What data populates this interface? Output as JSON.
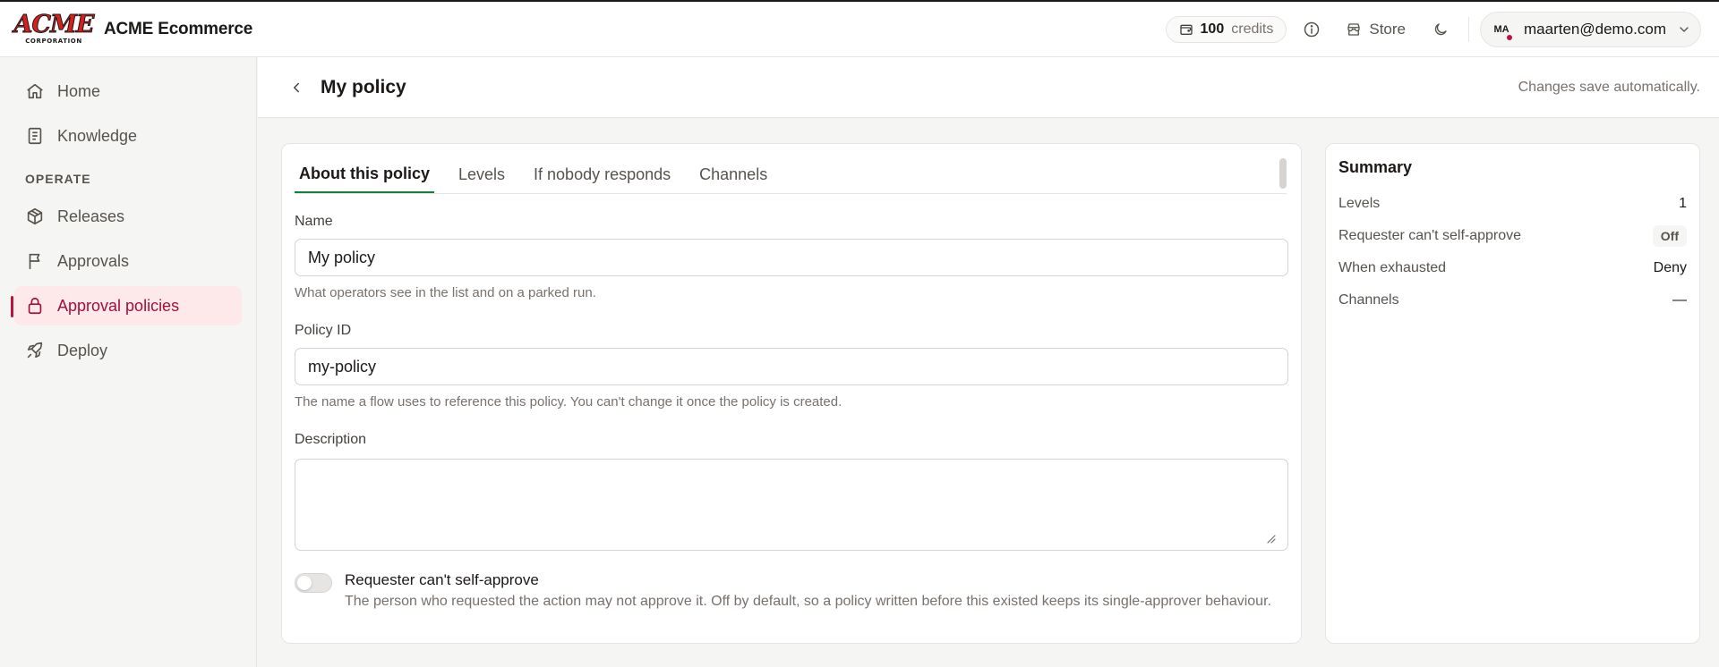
{
  "brand": {
    "logo_text": "ACME",
    "logo_subtext": "CORPORATION",
    "app_title": "ACME Ecommerce"
  },
  "topbar": {
    "credits_count": "100",
    "credits_label": "credits",
    "info_icon": "info-icon",
    "store_label": "Store",
    "theme_icon": "moon-icon",
    "user_initials": "MA",
    "user_email": "maarten@demo.com"
  },
  "sidebar": {
    "items": [
      {
        "label": "Home",
        "icon": "home-icon"
      },
      {
        "label": "Knowledge",
        "icon": "book-icon"
      }
    ],
    "section_label": "OPERATE",
    "operate_items": [
      {
        "label": "Releases",
        "icon": "package-icon"
      },
      {
        "label": "Approvals",
        "icon": "flag-icon"
      },
      {
        "label": "Approval policies",
        "icon": "lock-icon",
        "active": true
      },
      {
        "label": "Deploy",
        "icon": "rocket-icon"
      }
    ]
  },
  "header": {
    "title": "My policy",
    "autosave_note": "Changes save automatically."
  },
  "tabs": [
    {
      "label": "About this policy",
      "active": true
    },
    {
      "label": "Levels"
    },
    {
      "label": "If nobody responds"
    },
    {
      "label": "Channels"
    }
  ],
  "form": {
    "name": {
      "label": "Name",
      "value": "My policy",
      "helper": "What operators see in the list and on a parked run."
    },
    "policy_id": {
      "label": "Policy ID",
      "value": "my-policy",
      "helper": "The name a flow uses to reference this policy. You can't change it once the policy is created."
    },
    "description": {
      "label": "Description",
      "value": ""
    },
    "self_approve": {
      "title": "Requester can't self-approve",
      "description": "The person who requested the action may not approve it. Off by default, so a policy written before this existed keeps its single-approver behaviour.",
      "enabled": false
    }
  },
  "summary": {
    "title": "Summary",
    "rows": [
      {
        "key": "Levels",
        "value": "1"
      },
      {
        "key": "Requester can't self-approve",
        "value": "Off"
      },
      {
        "key": "When exhausted",
        "value": "Deny"
      },
      {
        "key": "Channels",
        "value": "—"
      }
    ]
  },
  "colors": {
    "accent": "#be123c",
    "active_bg": "#fde8ea",
    "tab_underline": "#15803d",
    "logo_red": "#d61f1f"
  }
}
